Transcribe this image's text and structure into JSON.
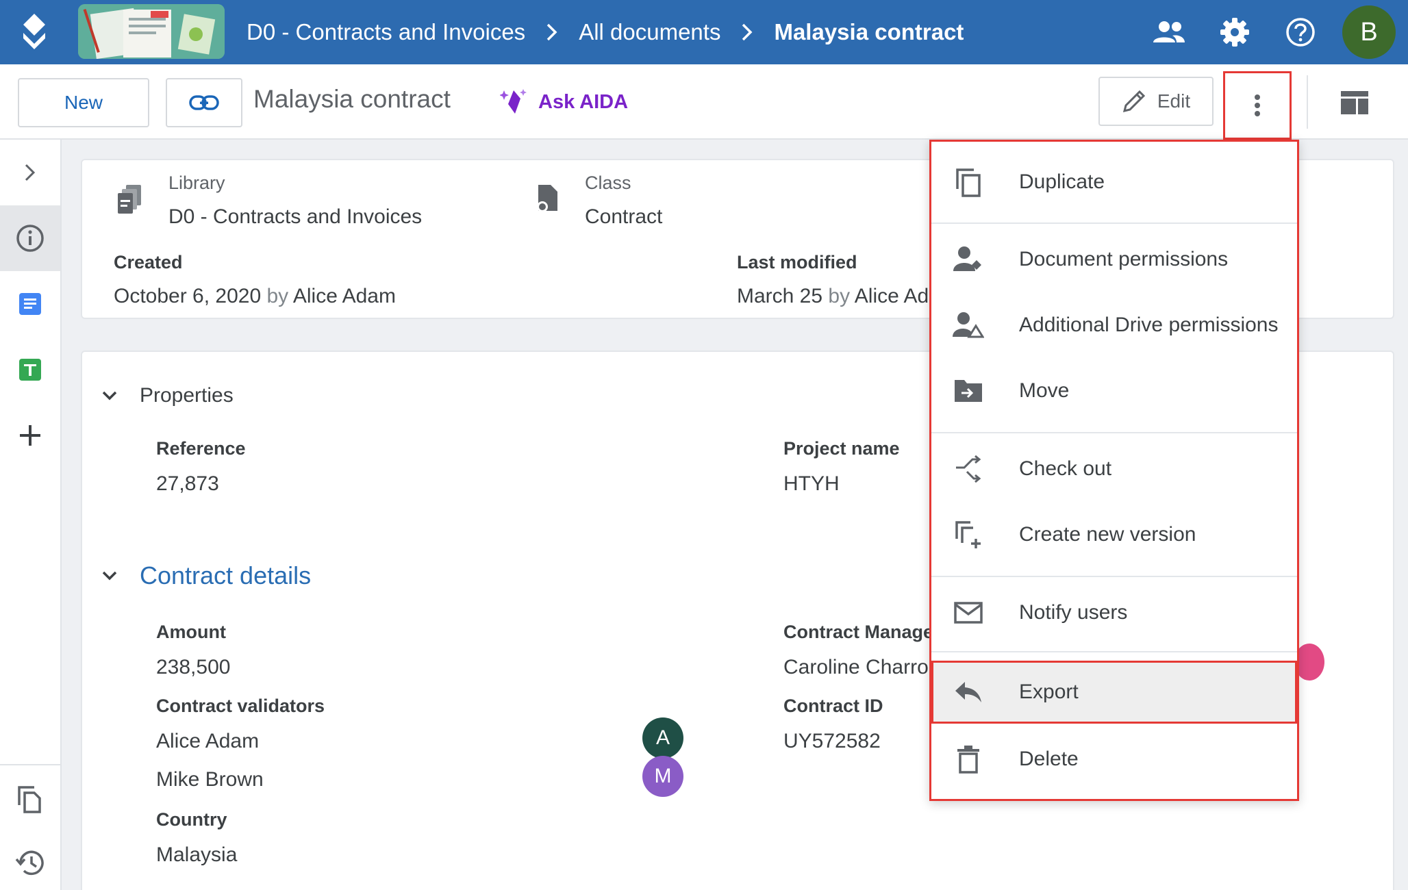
{
  "topbar": {
    "breadcrumbs": [
      "D0 - Contracts and Invoices",
      "All documents"
    ],
    "current": "Malaysia contract",
    "avatar_initial": "B"
  },
  "toolbar": {
    "new_label": "New",
    "doc_title": "Malaysia contract",
    "ask_aida_label": "Ask AIDA",
    "edit_label": "Edit"
  },
  "info": {
    "library_label": "Library",
    "library_value": "D0 - Contracts and Invoices",
    "class_label": "Class",
    "class_value": "Contract",
    "created_label": "Created",
    "created_date": "October 6, 2020",
    "created_by_word": "by",
    "created_by": "Alice Adam",
    "modified_label": "Last modified",
    "modified_date": "March 25",
    "modified_by_word": "by",
    "modified_by": "Alice Ad"
  },
  "properties": {
    "title": "Properties",
    "reference_label": "Reference",
    "reference_value": "27,873",
    "project_label": "Project name",
    "project_value": "HTYH"
  },
  "contract": {
    "title": "Contract details",
    "amount_label": "Amount",
    "amount_value": "238,500",
    "manager_label": "Contract Manage",
    "manager_value": "Caroline Charro",
    "validators_label": "Contract validators",
    "validators": [
      {
        "name": "Alice Adam",
        "initial": "A",
        "color": "#1f4f46"
      },
      {
        "name": "Mike Brown",
        "initial": "M",
        "color": "#8a5cc6"
      }
    ],
    "id_label": "Contract ID",
    "id_value": "UY572582",
    "country_label": "Country",
    "country_value": "Malaysia"
  },
  "menu": {
    "items": [
      {
        "label": "Duplicate",
        "icon": "duplicate-icon"
      },
      {
        "label": "Document permissions",
        "icon": "person-permission-icon"
      },
      {
        "label": "Additional Drive permissions",
        "icon": "person-drive-icon"
      },
      {
        "label": "Move",
        "icon": "move-folder-icon"
      },
      {
        "label": "Check out",
        "icon": "check-out-icon"
      },
      {
        "label": "Create new version",
        "icon": "new-version-icon"
      },
      {
        "label": "Notify users",
        "icon": "mail-icon"
      },
      {
        "label": "Export",
        "icon": "export-icon"
      },
      {
        "label": "Delete",
        "icon": "trash-icon"
      }
    ],
    "highlighted": "Export"
  },
  "colors": {
    "topbar": "#2d6bb0",
    "accent_blue": "#1a66b8",
    "aida_purple": "#7a23c9",
    "highlight_red": "#e53935"
  }
}
